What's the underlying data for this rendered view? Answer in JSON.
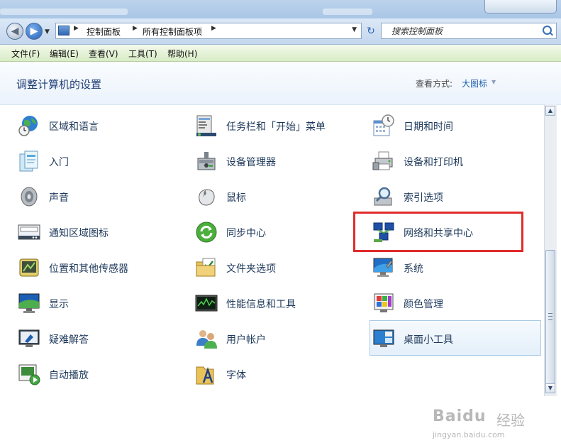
{
  "address_bar": {
    "breadcrumb": [
      "控制面板",
      "所有控制面板项"
    ],
    "search_placeholder": "搜索控制面板"
  },
  "menu": [
    "文件(F)",
    "编辑(E)",
    "查看(V)",
    "工具(T)",
    "帮助(H)"
  ],
  "header": {
    "title": "调整计算机的设置",
    "view_label": "查看方式:",
    "view_value": "大图标"
  },
  "items": [
    {
      "label": "区域和语言",
      "icon": "globe-clock-icon"
    },
    {
      "label": "任务栏和「开始」菜单",
      "icon": "taskbar-icon"
    },
    {
      "label": "日期和时间",
      "icon": "calendar-clock-icon"
    },
    {
      "label": "入门",
      "icon": "getting-started-icon"
    },
    {
      "label": "设备管理器",
      "icon": "device-manager-icon"
    },
    {
      "label": "设备和打印机",
      "icon": "printer-icon"
    },
    {
      "label": "声音",
      "icon": "speaker-icon"
    },
    {
      "label": "鼠标",
      "icon": "mouse-icon"
    },
    {
      "label": "索引选项",
      "icon": "magnifier-icon"
    },
    {
      "label": "通知区域图标",
      "icon": "notification-area-icon"
    },
    {
      "label": "同步中心",
      "icon": "sync-icon"
    },
    {
      "label": "网络和共享中心",
      "icon": "network-icon"
    },
    {
      "label": "位置和其他传感器",
      "icon": "sensor-icon"
    },
    {
      "label": "文件夹选项",
      "icon": "folder-options-icon"
    },
    {
      "label": "系统",
      "icon": "system-icon"
    },
    {
      "label": "显示",
      "icon": "monitor-icon"
    },
    {
      "label": "性能信息和工具",
      "icon": "performance-icon"
    },
    {
      "label": "颜色管理",
      "icon": "color-management-icon"
    },
    {
      "label": "疑难解答",
      "icon": "troubleshooting-icon"
    },
    {
      "label": "用户帐户",
      "icon": "user-accounts-icon"
    },
    {
      "label": "桌面小工具",
      "icon": "gadgets-icon"
    },
    {
      "label": "自动播放",
      "icon": "autoplay-icon"
    },
    {
      "label": "字体",
      "icon": "fonts-icon"
    }
  ],
  "watermark": {
    "logo": "Baidu",
    "text": "经验",
    "url": "jingyan.baidu.com"
  }
}
